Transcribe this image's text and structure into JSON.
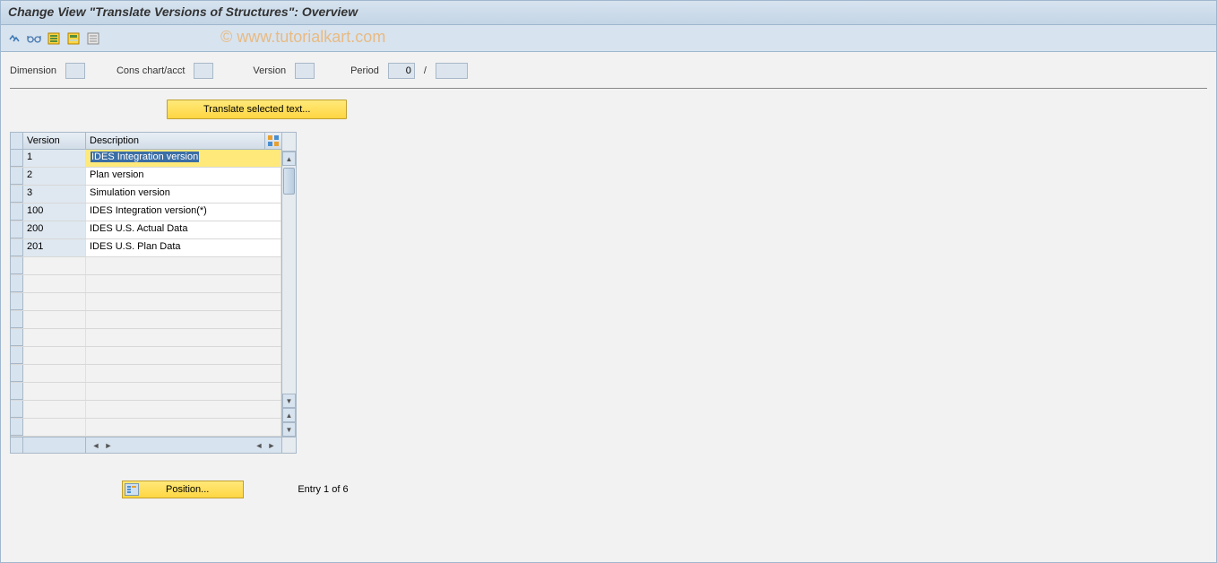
{
  "title": "Change View \"Translate Versions of Structures\": Overview",
  "watermark": "© www.tutorialkart.com",
  "params": {
    "dimension_label": "Dimension",
    "dimension_value": "",
    "cons_label": "Cons chart/acct",
    "cons_value": "",
    "version_label": "Version",
    "version_value": "",
    "period_label": "Period",
    "period_value": "0",
    "period_sep": "/",
    "period_value2": ""
  },
  "buttons": {
    "translate": "Translate selected text...",
    "position": "Position..."
  },
  "table": {
    "headers": {
      "version": "Version",
      "description": "Description"
    },
    "rows": [
      {
        "version": "1",
        "description": "IDES Integration version",
        "selected": true
      },
      {
        "version": "2",
        "description": "Plan version"
      },
      {
        "version": "3",
        "description": "Simulation version"
      },
      {
        "version": "100",
        "description": "IDES Integration version(*)"
      },
      {
        "version": "200",
        "description": "IDES U.S. Actual Data"
      },
      {
        "version": "201",
        "description": "IDES U.S. Plan Data"
      }
    ],
    "empty_rows": 10
  },
  "status": {
    "entry_text": "Entry 1 of 6"
  }
}
